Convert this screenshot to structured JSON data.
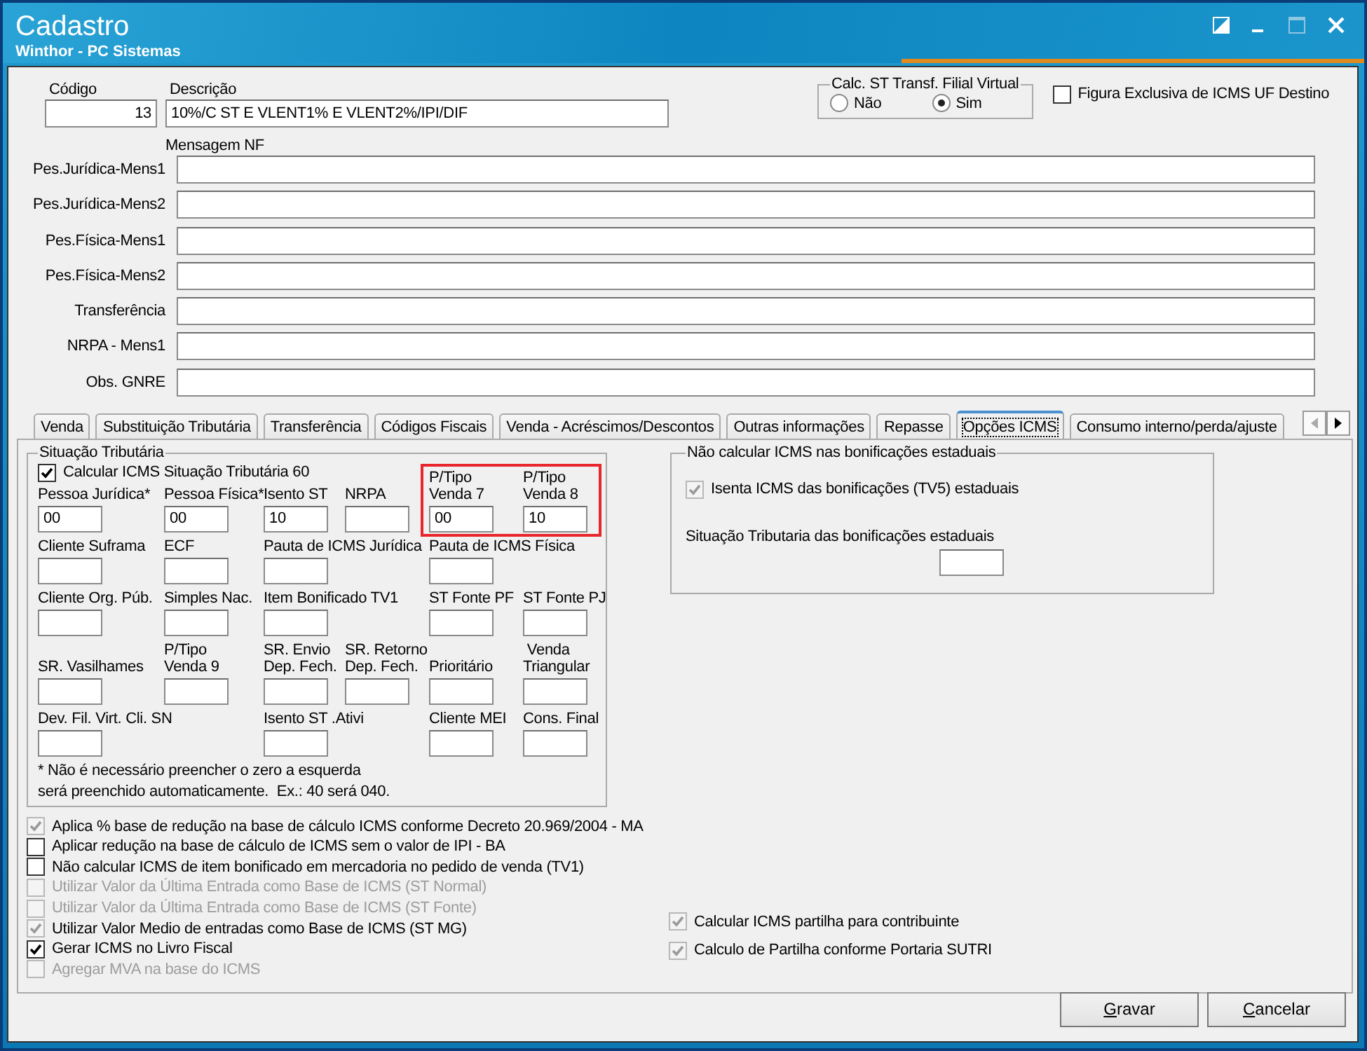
{
  "window": {
    "title": "Cadastro",
    "subtitle": "Winthor - PC Sistemas"
  },
  "header": {
    "codigo": {
      "label": "Código",
      "value": "13"
    },
    "descricao": {
      "label": "Descrição",
      "value": "10%/C ST E VLENT1% E VLENT2%/IPI/DIF"
    },
    "calc_st": {
      "title": "Calc. ST Transf. Filial Virtual",
      "options": [
        {
          "label": "Não",
          "selected": false
        },
        {
          "label": "Sim",
          "selected": true
        }
      ]
    },
    "figura_exclusiva": {
      "label": "Figura Exclusiva de ICMS UF Destino",
      "checked": false,
      "disabled": false,
      "label_greyed": false
    }
  },
  "mensagem": {
    "title": "Mensagem NF",
    "rows": [
      "Pes.Jurídica-Mens1",
      "Pes.Jurídica-Mens2",
      "Pes.Física-Mens1",
      "Pes.Física-Mens2",
      "Transferência",
      "NRPA - Mens1",
      "Obs. GNRE"
    ]
  },
  "tabs": [
    {
      "label": "Venda",
      "selected": false
    },
    {
      "label": "Substituição Tributária",
      "selected": false
    },
    {
      "label": "Transferência",
      "selected": false
    },
    {
      "label": "Códigos Fiscais",
      "selected": false
    },
    {
      "label": "Venda - Acréscimos/Descontos",
      "selected": false
    },
    {
      "label": "Outras informações",
      "selected": false
    },
    {
      "label": "Repasse",
      "selected": false
    },
    {
      "label": "Opções ICMS",
      "selected": true
    },
    {
      "label": "Consumo interno/perda/ajuste",
      "selected": false
    }
  ],
  "situacao": {
    "title": "Situação Tributária",
    "checkbox": {
      "label": "Calcular ICMS Situação Tributária 60",
      "checked": true,
      "disabled": false,
      "label_greyed": false
    },
    "rows": [
      [
        {
          "label": "Pessoa Jurídica*",
          "value": "00",
          "highlighted": false
        },
        {
          "label": "Pessoa Física*",
          "value": "00",
          "highlighted": false
        },
        {
          "label": "Isento ST",
          "value": "10",
          "highlighted": false
        },
        {
          "label": "NRPA",
          "highlighted": false
        },
        {
          "label": "P/Tipo\nVenda 7",
          "value": "00",
          "highlighted": true
        },
        {
          "label": "P/Tipo\nVenda 8",
          "value": "10",
          "highlighted": true
        }
      ],
      [
        {
          "label": "Cliente Suframa"
        },
        {
          "label": "ECF"
        },
        {
          "label": "Pauta de ICMS Jurídica"
        },
        null,
        {
          "label": "Pauta de ICMS Física"
        },
        null
      ],
      [
        {
          "label": "Cliente Org. Púb."
        },
        {
          "label": "Simples Nac."
        },
        {
          "label": "Item Bonificado TV1"
        },
        null,
        {
          "label": "ST Fonte PF"
        },
        {
          "label": "ST Fonte PJ"
        }
      ],
      [
        {
          "label": "SR. Vasilhames"
        },
        {
          "label": "P/Tipo\nVenda 9"
        },
        {
          "label": "SR. Envio\nDep. Fech."
        },
        {
          "label": "SR. Retorno\nDep. Fech."
        },
        {
          "label": "Prioritário"
        },
        {
          "label": " Venda\nTriangular"
        }
      ],
      [
        {
          "label": "Dev. Fil. Virt. Cli. SN"
        },
        null,
        {
          "label": "Isento ST .Ativi"
        },
        null,
        {
          "label": "Cliente MEI"
        },
        {
          "label": "Cons. Final"
        }
      ]
    ],
    "note": "* Não é necessário preencher o zero a esquerda\nserá preenchido automaticamente.  Ex.: 40 será 040."
  },
  "bonificacoes": {
    "title": "Não calcular ICMS nas bonificações estaduais",
    "checkbox": {
      "label": "Isenta ICMS das bonificações (TV5) estaduais",
      "checked": true,
      "disabled": true,
      "label_greyed": false
    },
    "field_label": "Situação Tributaria das  bonificações estaduais"
  },
  "options_left": [
    {
      "label": "Aplica % base de redução na base de cálculo ICMS conforme Decreto 20.969/2004 - MA",
      "checked": true,
      "disabled": true,
      "label_greyed": false
    },
    {
      "label": "Aplicar redução na base de cálculo de ICMS sem o valor de IPI - BA",
      "checked": false,
      "disabled": false,
      "label_greyed": false
    },
    {
      "label": "Não calcular ICMS de item bonificado em mercadoria no pedido de venda (TV1)",
      "checked": false,
      "disabled": false,
      "label_greyed": false
    },
    {
      "label": "Utilizar Valor da Última Entrada como Base de ICMS (ST Normal)",
      "checked": false,
      "disabled": true,
      "label_greyed": true
    },
    {
      "label": "Utilizar Valor da Última Entrada como Base de ICMS (ST Fonte)",
      "checked": false,
      "disabled": true,
      "label_greyed": true
    },
    {
      "label": "Utilizar Valor Medio de entradas como Base de ICMS (ST MG)",
      "checked": true,
      "disabled": true,
      "label_greyed": false
    },
    {
      "label": "Gerar ICMS no Livro Fiscal",
      "checked": true,
      "disabled": false,
      "label_greyed": false
    },
    {
      "label": "Agregar MVA na base do ICMS",
      "checked": false,
      "disabled": true,
      "label_greyed": true
    }
  ],
  "options_right": [
    {
      "label": "Calcular ICMS partilha para contribuinte",
      "checked": true,
      "disabled": true,
      "label_greyed": false
    },
    {
      "label": "Calculo de Partilha conforme Portaria SUTRI",
      "checked": true,
      "disabled": true,
      "label_greyed": false
    }
  ],
  "buttons": [
    "Gravar",
    "Cancelar"
  ]
}
